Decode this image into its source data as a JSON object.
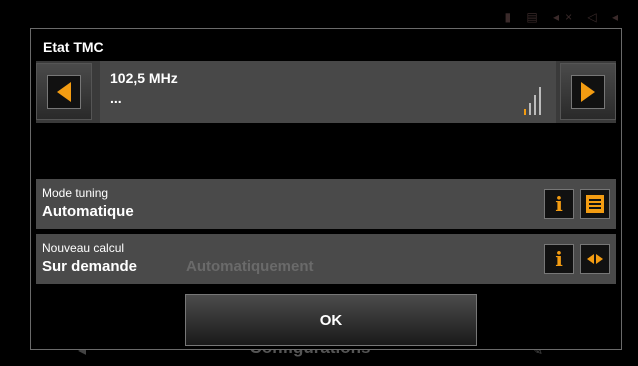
{
  "dialog": {
    "title": "Etat TMC",
    "ok_label": "OK"
  },
  "station": {
    "frequency": "102,5 MHz",
    "rds_text": "...",
    "signal_level": 0.25
  },
  "options": [
    {
      "label": "Mode tuning",
      "value": "Automatique",
      "alt_value": ""
    },
    {
      "label": "Nouveau calcul",
      "value": "Sur demande",
      "alt_value": "Automatiquement"
    }
  ],
  "background": {
    "bottom_label": "Configurations"
  },
  "colors": {
    "accent": "#f39c12"
  }
}
